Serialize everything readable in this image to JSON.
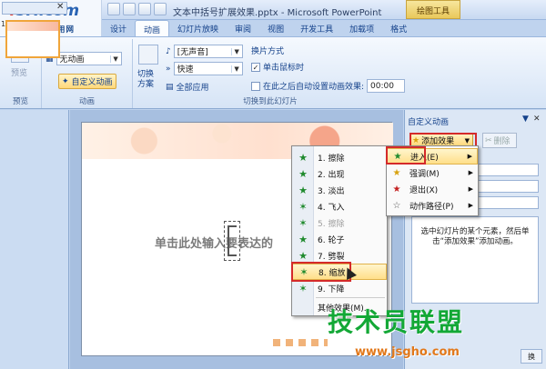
{
  "logo": {
    "main_a": "4",
    "main_b": "5IT.com",
    "sub": "电脑软硬件应用网"
  },
  "titlebar": {
    "document_title": "文本中括号扩展效果.pptx - Microsoft PowerPoint",
    "context_tab": "绘图工具"
  },
  "tabs": [
    {
      "label": "设计"
    },
    {
      "label": "动画"
    },
    {
      "label": "幻灯片放映"
    },
    {
      "label": "审阅"
    },
    {
      "label": "视图"
    },
    {
      "label": "开发工具"
    },
    {
      "label": "加载项"
    },
    {
      "label": "格式"
    }
  ],
  "ribbon": {
    "preview": {
      "button": "预览",
      "group": "预览"
    },
    "animation": {
      "effect_value": "无动画",
      "custom_button": "自定义动画",
      "group": "动画"
    },
    "transition": {
      "scheme_button_a": "切换",
      "scheme_button_b": "方案",
      "sound_value": "[无声音]",
      "speed_value": "快速",
      "apply_all": "全部应用",
      "advance_title": "换片方式",
      "on_click": "单击鼠标时",
      "auto_after": "在此之后自动设置动画效果:",
      "time_value": "00:00",
      "group": "切换到此幻灯片"
    }
  },
  "slide": {
    "placeholder_text": "单击此处输入要表达的",
    "thumb_number": "1"
  },
  "context_menu": {
    "items": [
      {
        "label": "1. 擦除",
        "icon": "green-star-icon",
        "disabled": false
      },
      {
        "label": "2. 出现",
        "icon": "green-star-icon",
        "disabled": false
      },
      {
        "label": "3. 淡出",
        "icon": "green-star-icon",
        "disabled": false
      },
      {
        "label": "4. 飞入",
        "icon": "green-star-icon",
        "disabled": false
      },
      {
        "label": "5. 擦除",
        "icon": "green-star-icon",
        "disabled": true
      },
      {
        "label": "6. 轮子",
        "icon": "green-star-icon",
        "disabled": false
      },
      {
        "label": "7. 劈裂",
        "icon": "green-star-icon",
        "disabled": false
      },
      {
        "label": "8. 缩放",
        "icon": "green-star-icon",
        "disabled": false,
        "active": true
      },
      {
        "label": "9. 下降",
        "icon": "green-star-icon",
        "disabled": false
      }
    ],
    "more": "其他效果(M)..."
  },
  "task_pane": {
    "title": "自定义动画",
    "add_effect": "添加效果",
    "delete": "删除",
    "hint": "选中幻灯片的某个元素，然后单击“添加效果”添加动画。",
    "bottom_button": "换"
  },
  "submenu": {
    "items": [
      {
        "label": "进入(E)",
        "icon": "green-star-icon",
        "active": true
      },
      {
        "label": "强调(M)",
        "icon": "gold-star-icon"
      },
      {
        "label": "退出(X)",
        "icon": "red-star-icon"
      },
      {
        "label": "动作路径(P)",
        "icon": "outline-star-icon"
      }
    ]
  },
  "watermark": {
    "main": "技术员联盟",
    "url": "www.jsgho.com"
  }
}
